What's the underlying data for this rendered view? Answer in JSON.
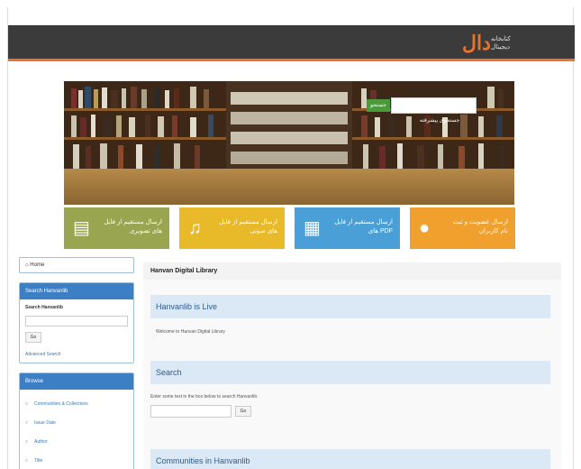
{
  "header": {
    "logo_mark": "دال",
    "logo_text_line1": "کتابخانه",
    "logo_text_line2": "دیجیتال"
  },
  "banner": {
    "search_button": "جستجو",
    "advanced_link": "جستجوی پیشرفته"
  },
  "tiles": [
    {
      "label": "ارسال مستقیم از فایل های تصویری",
      "icon": "film-icon"
    },
    {
      "label": "ارسال مستقیم از فایل های صوتی",
      "icon": "music-icon"
    },
    {
      "label": "ارسال مستقیم از فایل های PDF",
      "icon": "pdf-icon"
    },
    {
      "label": "ارسال عضویت و ثبت نام کاربران",
      "icon": "users-icon"
    }
  ],
  "sidebar": {
    "home_label": "Home",
    "search_panel_title": "Search Hanvanlib",
    "search_label": "Search Hanvanlib",
    "go_button": "Go",
    "advanced_search": "Advanced Search",
    "browse_title": "Browse",
    "browse_items": [
      "Communities & Collections",
      "Issue Date",
      "Author",
      "Title"
    ]
  },
  "main": {
    "breadcrumb": "Hanvan Digital Library",
    "live_title": "Hanvanlib is Live",
    "welcome_text": "Welcome to Hanvan Digital Library",
    "search_title": "Search",
    "search_hint": "Enter some text in the box below to search Hanvanlib.",
    "go_button": "Go",
    "communities_title": "Communities in Hanvanlib"
  }
}
